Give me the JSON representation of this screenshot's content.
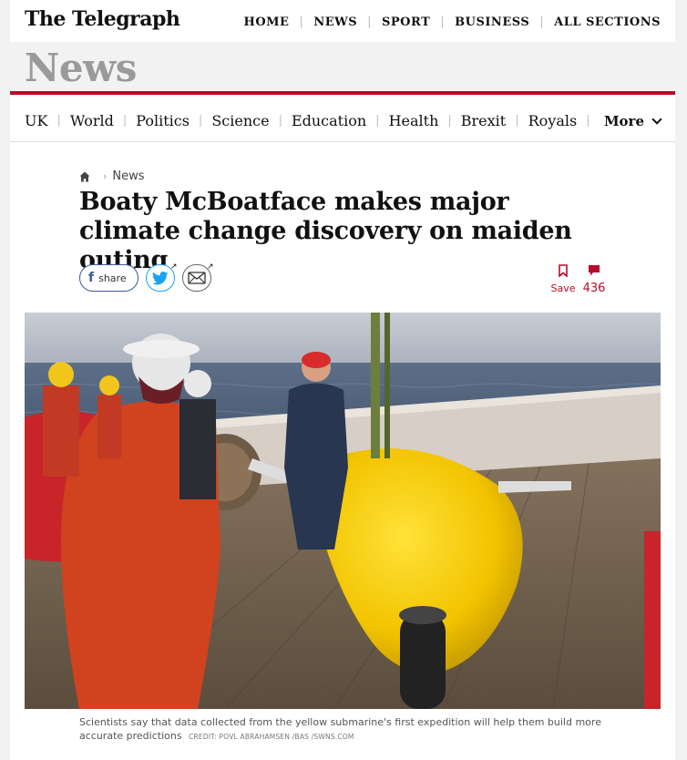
{
  "masthead": {
    "logo": "The Telegraph",
    "nav": [
      "HOME",
      "NEWS",
      "SPORT",
      "BUSINESS",
      "ALL SECTIONS"
    ]
  },
  "section": {
    "title": "News"
  },
  "subnav": {
    "items": [
      "UK",
      "World",
      "Politics",
      "Science",
      "Education",
      "Health",
      "Brexit",
      "Royals"
    ],
    "more_label": "More"
  },
  "breadcrumb": {
    "current": "News"
  },
  "article": {
    "headline": "Boaty McBoatface makes major climate change discovery on maiden outing",
    "share_label": "share",
    "save_label": "Save",
    "comment_count": "436",
    "caption": "Scientists say that data collected from the yellow submarine's first expedition will help them build more accurate predictions",
    "credit": "CREDIT: POVL ABRAHAMSEN /BAS /SWNS.COM"
  },
  "colors": {
    "brand_red": "#b70a29",
    "facebook": "#3b5998",
    "twitter": "#1da1f2",
    "submarine_yellow": "#f2c400"
  },
  "icons": [
    "home-icon",
    "facebook-icon",
    "twitter-icon",
    "email-icon",
    "bookmark-icon",
    "comment-icon",
    "chevron-down-icon"
  ]
}
